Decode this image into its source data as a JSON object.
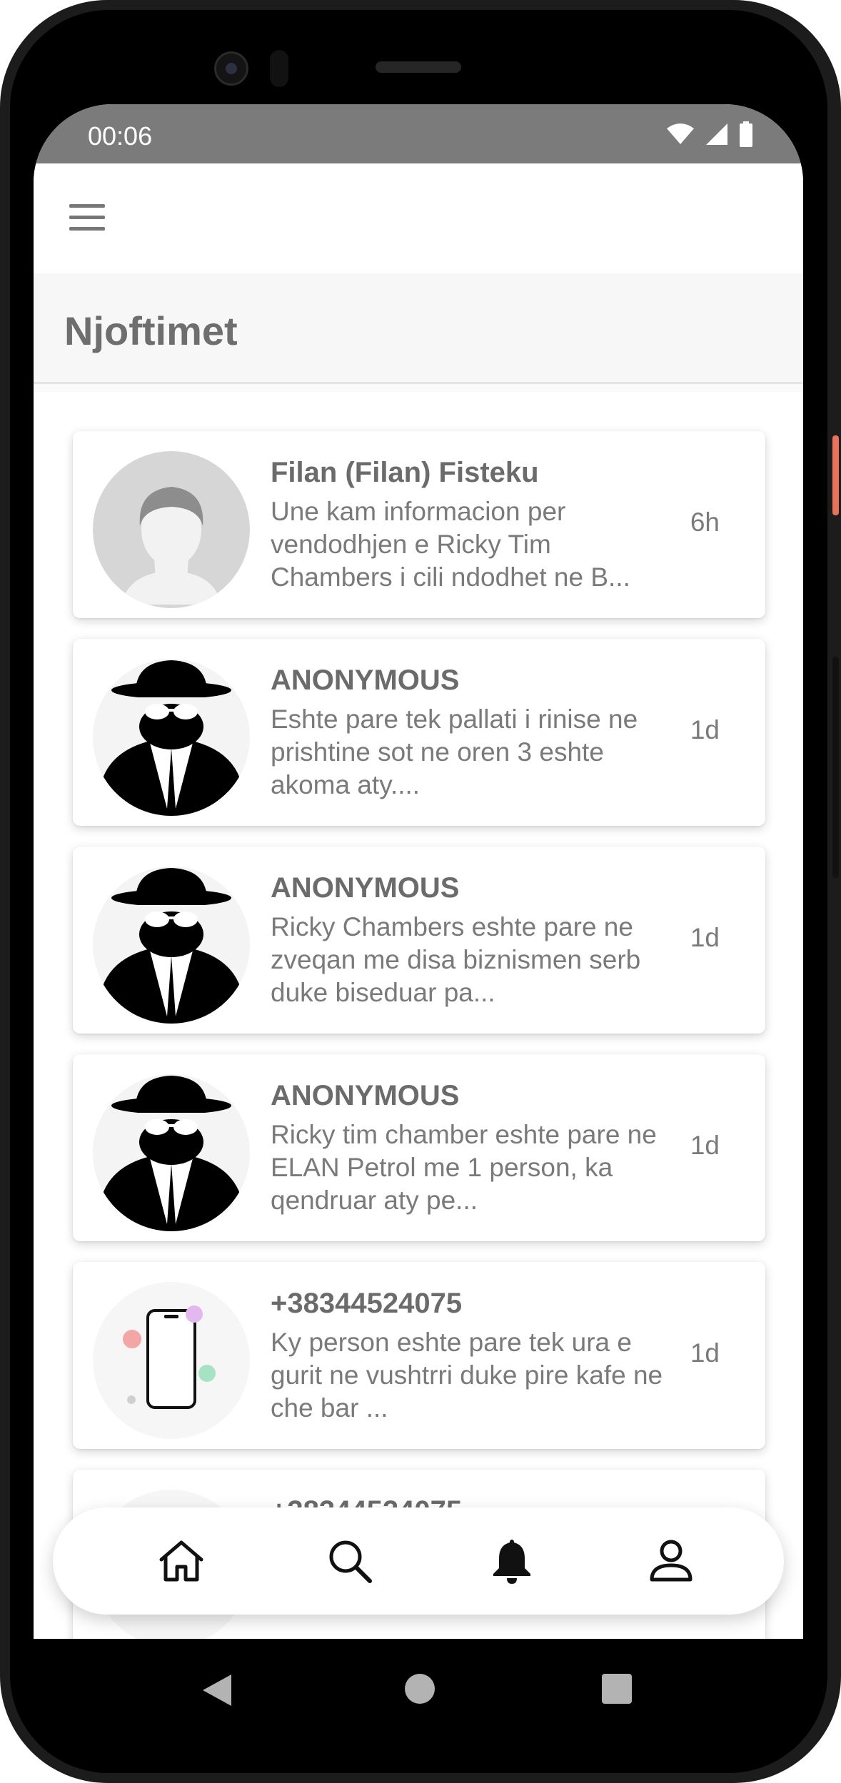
{
  "status_bar": {
    "time": "00:06",
    "icons": [
      "wifi-icon",
      "signal-icon",
      "battery-icon"
    ]
  },
  "app_bar": {
    "menu_icon": "hamburger-menu-icon"
  },
  "page": {
    "title": "Njoftimet"
  },
  "notifications": [
    {
      "sender": "Filan (Filan) Fisteku",
      "message": "Une kam informacion per vendodhjen e Ricky Tim Chambers i cili ndodhet ne B...",
      "time": "6h",
      "avatar": "default-person-avatar"
    },
    {
      "sender": "ANONYMOUS",
      "message": "Eshte pare tek pallati i rinise ne prishtine sot ne oren 3 eshte akoma aty....",
      "time": "1d",
      "avatar": "anonymous-spy-avatar"
    },
    {
      "sender": "ANONYMOUS",
      "message": "Ricky Chambers eshte pare ne zveqan me disa biznismen serb duke biseduar pa...",
      "time": "1d",
      "avatar": "anonymous-spy-avatar"
    },
    {
      "sender": "ANONYMOUS",
      "message": "Ricky tim chamber eshte pare ne ELAN Petrol me 1 person, ka qendruar aty pe...",
      "time": "1d",
      "avatar": "anonymous-spy-avatar"
    },
    {
      "sender": "+38344524075",
      "message": "Ky person eshte pare tek ura e gurit ne vushtrri duke pire kafe ne che bar ...",
      "time": "1d",
      "avatar": "phone-contact-avatar"
    },
    {
      "sender": "+38344524075",
      "message": "",
      "time": "",
      "avatar": "phone-contact-avatar"
    }
  ],
  "bottom_nav": {
    "items": [
      "home-icon",
      "search-icon",
      "bell-icon",
      "profile-icon"
    ],
    "active": "bell-icon"
  },
  "system_nav": {
    "items": [
      "back-icon",
      "home-circle-icon",
      "recents-icon"
    ]
  },
  "colors": {
    "status_bar": "#7b7b7b",
    "title_text": "#6e6e6e",
    "body_text": "#7a7a7a",
    "card_bg": "#ffffff",
    "page_bg": "#fafafa",
    "power_button": "#e8735a"
  }
}
